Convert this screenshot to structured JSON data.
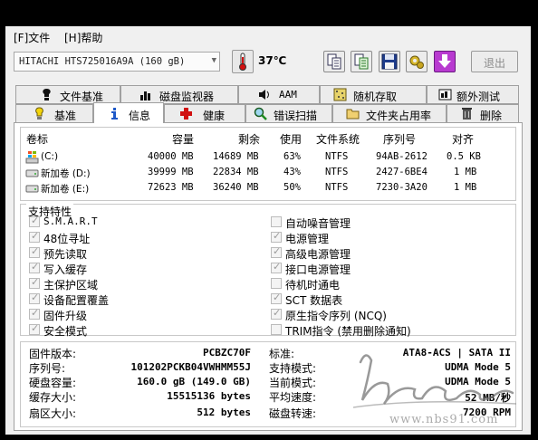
{
  "menu": {
    "file": "[F]文件",
    "help": "[H]帮助"
  },
  "toolbar": {
    "disk": "HITACHI HTS725016A9A  (160 gB)",
    "temperature": "37℃",
    "exit_label": "退出",
    "buttons": [
      "copy-icon",
      "copy-green-icon",
      "save-icon",
      "settings-icon",
      "down-arrow-icon"
    ]
  },
  "tabs_top": [
    {
      "label": "文件基准",
      "icon": "file-benchmark-icon"
    },
    {
      "label": "磁盘监视器",
      "icon": "disk-monitor-icon"
    },
    {
      "label": "AAM",
      "icon": "speaker-icon"
    },
    {
      "label": "随机存取",
      "icon": "random-access-icon"
    },
    {
      "label": "额外测试",
      "icon": "extra-tests-icon"
    }
  ],
  "tabs_bottom": [
    {
      "label": "基准",
      "icon": "benchmark-icon"
    },
    {
      "label": "信息",
      "icon": "info-icon",
      "active": true
    },
    {
      "label": "健康",
      "icon": "health-icon"
    },
    {
      "label": "错误扫描",
      "icon": "error-scan-icon"
    },
    {
      "label": "文件夹占用率",
      "icon": "folder-usage-icon"
    },
    {
      "label": "删除",
      "icon": "erase-icon"
    }
  ],
  "volumes": {
    "headers": [
      "卷标",
      "容量",
      "剩余",
      "使用",
      "文件系统",
      "序列号",
      "对齐"
    ],
    "rows": [
      [
        "(C:)",
        "40000 MB",
        "14689 MB",
        "63%",
        "NTFS",
        "94AB-2612",
        "0.5 KB"
      ],
      [
        "新加卷 (D:)",
        "39999 MB",
        "22834 MB",
        "43%",
        "NTFS",
        "2427-6BE4",
        "1 MB"
      ],
      [
        "新加卷 (E:)",
        "72623 MB",
        "36240 MB",
        "50%",
        "NTFS",
        "7230-3A20",
        "1 MB"
      ]
    ]
  },
  "features": {
    "title": "支持特性",
    "left": [
      {
        "label": "S.M.A.R.T",
        "checked": true
      },
      {
        "label": "48位寻址",
        "checked": true
      },
      {
        "label": "预先读取",
        "checked": true
      },
      {
        "label": "写入缓存",
        "checked": true
      },
      {
        "label": "主保护区域",
        "checked": true
      },
      {
        "label": "设备配置覆盖",
        "checked": true
      },
      {
        "label": "固件升级",
        "checked": true
      },
      {
        "label": "安全模式",
        "checked": true
      }
    ],
    "right": [
      {
        "label": "自动噪音管理",
        "checked": false
      },
      {
        "label": "电源管理",
        "checked": true
      },
      {
        "label": "高级电源管理",
        "checked": true
      },
      {
        "label": "接口电源管理",
        "checked": true
      },
      {
        "label": "待机时通电",
        "checked": false
      },
      {
        "label": "SCT 数据表",
        "checked": true
      },
      {
        "label": "原生指令序列 (NCQ)",
        "checked": true
      },
      {
        "label": "TRIM指令 (禁用删除通知)",
        "checked": false
      }
    ]
  },
  "info": {
    "left": [
      {
        "label": "固件版本:",
        "value": "PCBZC70F"
      },
      {
        "label": "序列号:",
        "value": "101202PCKB04VWHMM55J"
      },
      {
        "label": "硬盘容量:",
        "value": "160.0 gB (149.0 GB)"
      },
      {
        "label": "缓存大小:",
        "value": "15515136 bytes"
      },
      {
        "label": "扇区大小:",
        "value": "512 bytes"
      }
    ],
    "right": [
      {
        "label": "标准:",
        "value": "ATA8-ACS | SATA II"
      },
      {
        "label": "支持模式:",
        "value": "UDMA Mode 5"
      },
      {
        "label": "当前模式:",
        "value": "UDMA Mode 5"
      },
      {
        "label": "平均速度:",
        "value": "52 MB/秒"
      },
      {
        "label": "磁盘转速:",
        "value": "7200 RPM"
      }
    ]
  },
  "watermark": {
    "url": "www.nbs91.com"
  },
  "colors": {
    "accent": "#1a3e8c",
    "info_blue": "#1d58c8",
    "health_red": "#d01010",
    "erase_purple": "#a020c0"
  }
}
